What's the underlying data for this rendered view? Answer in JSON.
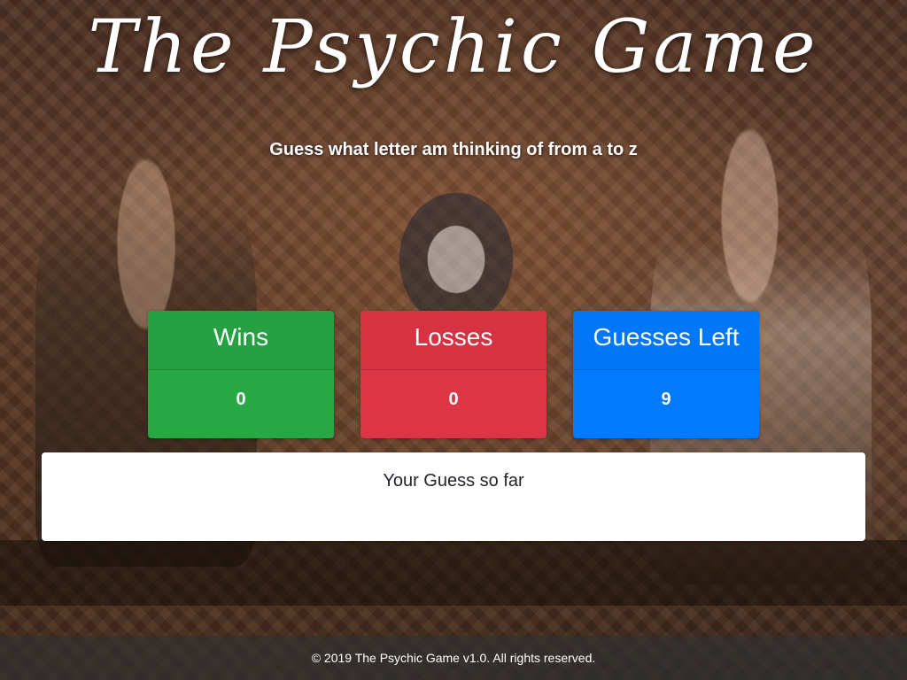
{
  "header": {
    "title": "The Psychic Game",
    "subtitle": "Guess what letter am thinking of from a to z"
  },
  "scoreboard": {
    "wins": {
      "label": "Wins",
      "value": "0",
      "color": "#28a745"
    },
    "losses": {
      "label": "Losses",
      "value": "0",
      "color": "#dc3545"
    },
    "guesses_left": {
      "label": "Guesses Left",
      "value": "9",
      "color": "#007bff"
    }
  },
  "guess_panel": {
    "title": "Your Guess so far",
    "letters": ""
  },
  "footer": {
    "text": "© 2019 The Psychic Game v1.0. All rights reserved."
  }
}
